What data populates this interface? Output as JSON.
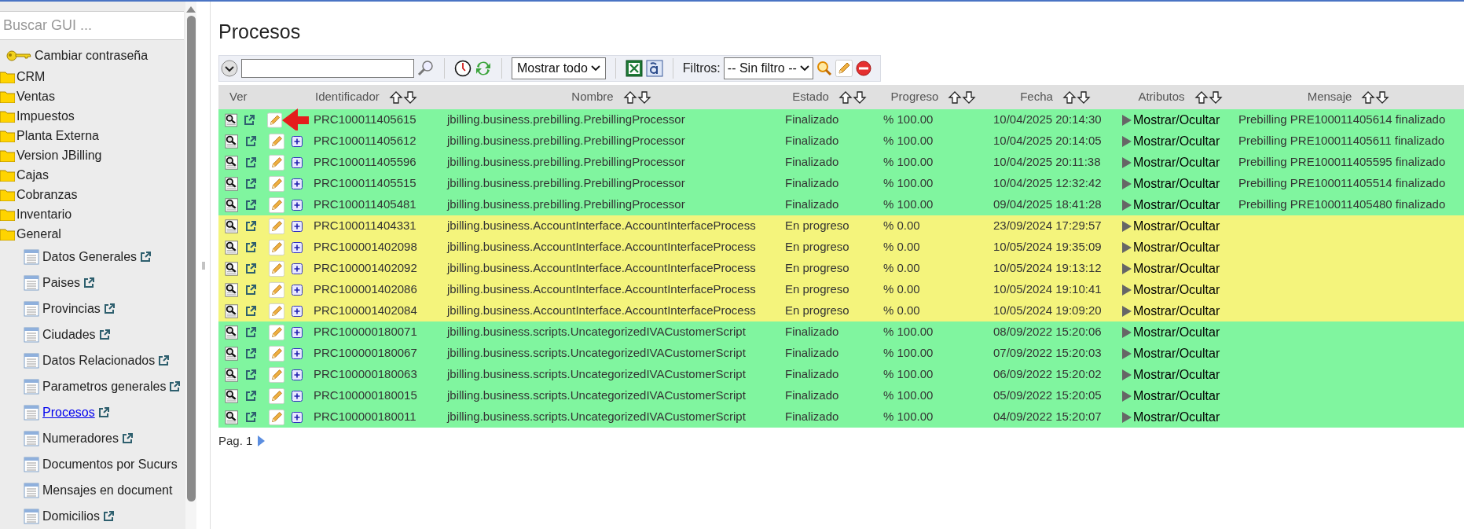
{
  "sidebar": {
    "search": {
      "placeholder": "Buscar GUI ..."
    },
    "items": [
      {
        "kind": "action",
        "label": "Cambiar contraseña"
      },
      {
        "kind": "folder",
        "label": "CRM"
      },
      {
        "kind": "folder",
        "label": "Ventas"
      },
      {
        "kind": "folder",
        "label": "Impuestos"
      },
      {
        "kind": "folder",
        "label": "Planta Externa"
      },
      {
        "kind": "folder",
        "label": "Version JBilling"
      },
      {
        "kind": "folder",
        "label": "Cajas"
      },
      {
        "kind": "folder",
        "label": "Cobranzas"
      },
      {
        "kind": "folder",
        "label": "Inventario"
      },
      {
        "kind": "folder",
        "label": "General",
        "children": [
          {
            "label": "Datos Generales",
            "selected": false,
            "link_icon": true
          },
          {
            "label": "Paises",
            "selected": false,
            "link_icon": true
          },
          {
            "label": "Provincias",
            "selected": false,
            "link_icon": true
          },
          {
            "label": "Ciudades",
            "selected": false,
            "link_icon": true
          },
          {
            "label": "Datos Relacionados",
            "selected": false,
            "link_icon": true
          },
          {
            "label": "Parametros generales",
            "selected": false,
            "link_icon": true
          },
          {
            "label": "Procesos",
            "selected": true,
            "link_icon": true
          },
          {
            "label": "Numeradores",
            "selected": false,
            "link_icon": true
          },
          {
            "label": "Documentos por Sucurs",
            "selected": false,
            "link_icon": false
          },
          {
            "label": "Mensajes en document",
            "selected": false,
            "link_icon": false
          },
          {
            "label": "Domicilios",
            "selected": false,
            "link_icon": true
          }
        ]
      }
    ]
  },
  "title": "Procesos",
  "toolbar": {
    "view_select": "Mostrar todo",
    "filters_label": "Filtros:",
    "filter_select": "-- Sin filtro --"
  },
  "table": {
    "columns": [
      "Ver",
      "Identificador",
      "Nombre",
      "Estado",
      "Progreso",
      "Fecha",
      "Atributos",
      "Mensaje"
    ],
    "rows": [
      {
        "color": "#80f59f",
        "annotated": true,
        "id": "PRC100011405615",
        "nombre": "jbilling.business.prebilling.PrebillingProcessor",
        "estado": "Finalizado",
        "progreso": "% 100.00",
        "fecha": "10/04/2025 20:14:30",
        "atributos": "Mostrar/Ocultar",
        "mensaje": "Prebilling PRE100011405614 finalizado"
      },
      {
        "color": "#80f59f",
        "annotated": false,
        "id": "PRC100011405612",
        "nombre": "jbilling.business.prebilling.PrebillingProcessor",
        "estado": "Finalizado",
        "progreso": "% 100.00",
        "fecha": "10/04/2025 20:14:05",
        "atributos": "Mostrar/Ocultar",
        "mensaje": "Prebilling PRE100011405611 finalizado"
      },
      {
        "color": "#80f59f",
        "annotated": false,
        "id": "PRC100011405596",
        "nombre": "jbilling.business.prebilling.PrebillingProcessor",
        "estado": "Finalizado",
        "progreso": "% 100.00",
        "fecha": "10/04/2025 20:11:38",
        "atributos": "Mostrar/Ocultar",
        "mensaje": "Prebilling PRE100011405595 finalizado"
      },
      {
        "color": "#80f59f",
        "annotated": false,
        "id": "PRC100011405515",
        "nombre": "jbilling.business.prebilling.PrebillingProcessor",
        "estado": "Finalizado",
        "progreso": "% 100.00",
        "fecha": "10/04/2025 12:32:42",
        "atributos": "Mostrar/Ocultar",
        "mensaje": "Prebilling PRE100011405514 finalizado"
      },
      {
        "color": "#80f59f",
        "annotated": false,
        "id": "PRC100011405481",
        "nombre": "jbilling.business.prebilling.PrebillingProcessor",
        "estado": "Finalizado",
        "progreso": "% 100.00",
        "fecha": "09/04/2025 18:41:28",
        "atributos": "Mostrar/Ocultar",
        "mensaje": "Prebilling PRE100011405480 finalizado"
      },
      {
        "color": "#f4f47c",
        "annotated": false,
        "id": "PRC100011404331",
        "nombre": "jbilling.business.AccountInterface.AccountInterfaceProcess",
        "estado": "En progreso",
        "progreso": "% 0.00",
        "fecha": "23/09/2024 17:29:57",
        "atributos": "Mostrar/Ocultar"
      },
      {
        "color": "#f4f47c",
        "annotated": false,
        "id": "PRC100001402098",
        "nombre": "jbilling.business.AccountInterface.AccountInterfaceProcess",
        "estado": "En progreso",
        "progreso": "% 0.00",
        "fecha": "10/05/2024 19:35:09",
        "atributos": "Mostrar/Ocultar"
      },
      {
        "color": "#f4f47c",
        "annotated": false,
        "id": "PRC100001402092",
        "nombre": "jbilling.business.AccountInterface.AccountInterfaceProcess",
        "estado": "En progreso",
        "progreso": "% 0.00",
        "fecha": "10/05/2024 19:13:12",
        "atributos": "Mostrar/Ocultar"
      },
      {
        "color": "#f4f47c",
        "annotated": false,
        "id": "PRC100001402086",
        "nombre": "jbilling.business.AccountInterface.AccountInterfaceProcess",
        "estado": "En progreso",
        "progreso": "% 0.00",
        "fecha": "10/05/2024 19:10:41",
        "atributos": "Mostrar/Ocultar"
      },
      {
        "color": "#f4f47c",
        "annotated": false,
        "id": "PRC100001402084",
        "nombre": "jbilling.business.AccountInterface.AccountInterfaceProcess",
        "estado": "En progreso",
        "progreso": "% 0.00",
        "fecha": "10/05/2024 19:09:20",
        "atributos": "Mostrar/Ocultar"
      },
      {
        "color": "#80f59f",
        "annotated": false,
        "id": "PRC100000180071",
        "nombre": "jbilling.business.scripts.UncategorizedIVACustomerScript",
        "estado": "Finalizado",
        "progreso": "% 100.00",
        "fecha": "08/09/2022 15:20:06",
        "atributos": "Mostrar/Ocultar"
      },
      {
        "color": "#80f59f",
        "annotated": false,
        "id": "PRC100000180067",
        "nombre": "jbilling.business.scripts.UncategorizedIVACustomerScript",
        "estado": "Finalizado",
        "progreso": "% 100.00",
        "fecha": "07/09/2022 15:20:03",
        "atributos": "Mostrar/Ocultar"
      },
      {
        "color": "#80f59f",
        "annotated": false,
        "id": "PRC100000180063",
        "nombre": "jbilling.business.scripts.UncategorizedIVACustomerScript",
        "estado": "Finalizado",
        "progreso": "% 100.00",
        "fecha": "06/09/2022 15:20:02",
        "atributos": "Mostrar/Ocultar"
      },
      {
        "color": "#80f59f",
        "annotated": false,
        "id": "PRC100000180015",
        "nombre": "jbilling.business.scripts.UncategorizedIVACustomerScript",
        "estado": "Finalizado",
        "progreso": "% 100.00",
        "fecha": "05/09/2022 15:20:05",
        "atributos": "Mostrar/Ocultar"
      },
      {
        "color": "#80f59f",
        "annotated": false,
        "id": "PRC100000180011",
        "nombre": "jbilling.business.scripts.UncategorizedIVACustomerScript",
        "estado": "Finalizado",
        "progreso": "% 100.00",
        "fecha": "04/09/2022 15:20:07",
        "atributos": "Mostrar/Ocultar"
      }
    ]
  },
  "pager": {
    "label": "Pag. 1"
  }
}
